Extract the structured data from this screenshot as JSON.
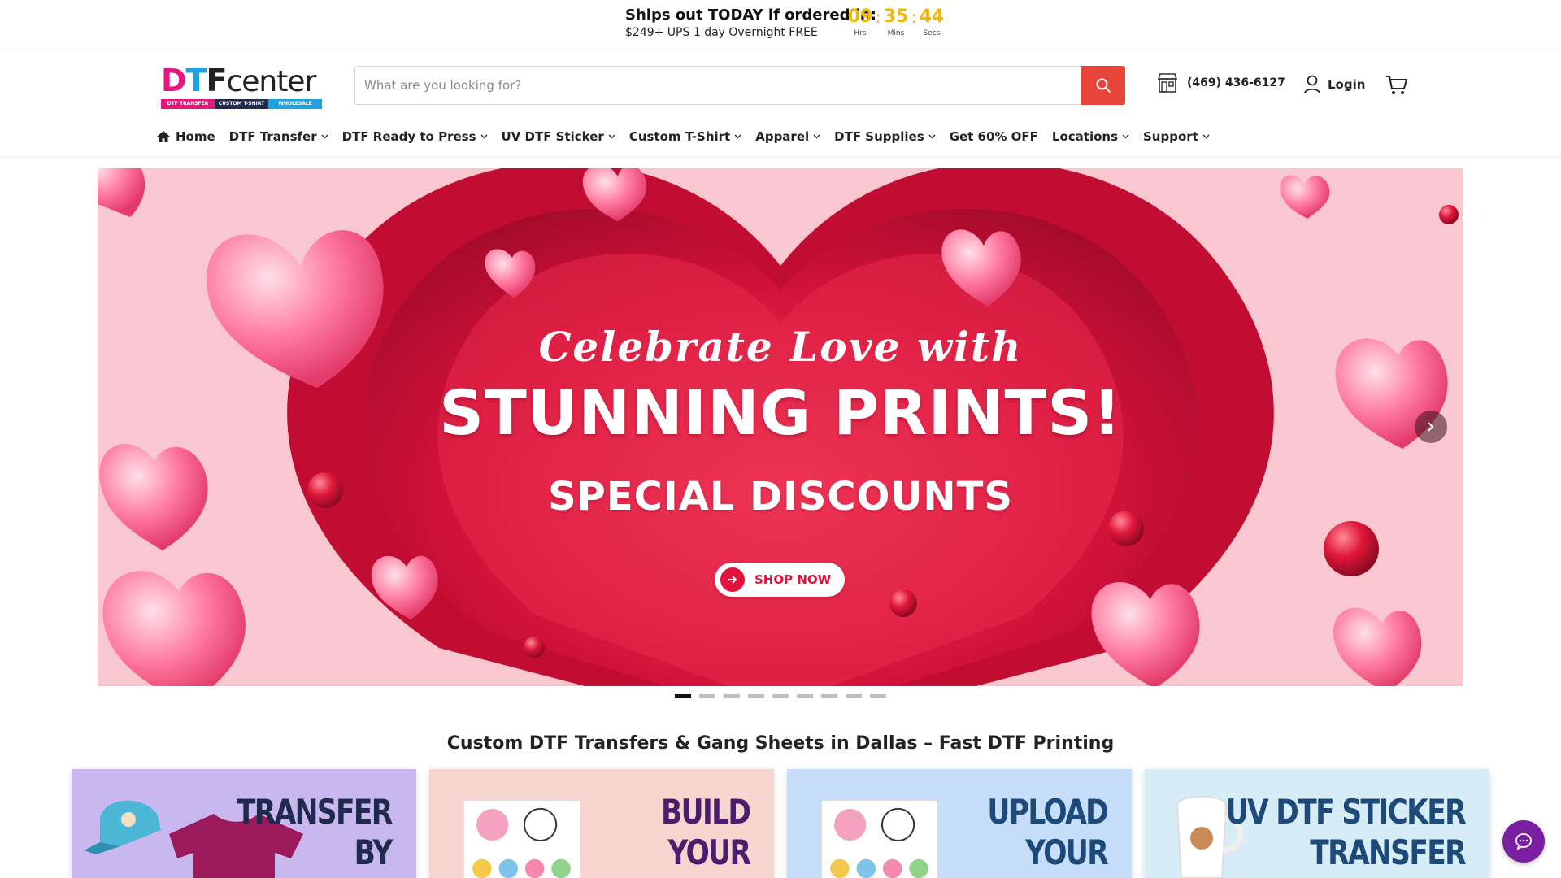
{
  "promo": {
    "title": "Ships out TODAY if ordered in:",
    "subtitle": "$249+ UPS 1 day Overnight FREE",
    "countdown": {
      "hours": "09",
      "minutes": "35",
      "seconds": "44",
      "hours_label": "Hrs",
      "minutes_label": "Mins",
      "seconds_label": "Secs",
      "separator": ":"
    }
  },
  "header": {
    "logo": {
      "word_d": "D",
      "word_t": "T",
      "word_f": "F",
      "word_rest": "center",
      "strip": [
        "DTF TRANSFER",
        "CUSTOM T-SHIRT",
        "WHOLESALE"
      ]
    },
    "search": {
      "placeholder": "What are you looking for?",
      "value": ""
    },
    "phone": "(469) 436-6127",
    "login_label": "Login"
  },
  "nav": {
    "items": [
      {
        "label": "Home",
        "icon": "home-icon",
        "dropdown": false
      },
      {
        "label": "DTF Transfer",
        "dropdown": true
      },
      {
        "label": "DTF Ready to Press",
        "dropdown": true
      },
      {
        "label": "UV DTF Sticker",
        "dropdown": true
      },
      {
        "label": "Custom T-Shirt",
        "dropdown": true
      },
      {
        "label": "Apparel",
        "dropdown": true
      },
      {
        "label": "DTF Supplies",
        "dropdown": true
      },
      {
        "label": "Get 60% OFF",
        "dropdown": false
      },
      {
        "label": "Locations",
        "dropdown": true
      },
      {
        "label": "Support",
        "dropdown": true
      }
    ]
  },
  "hero": {
    "script": "Celebrate Love with",
    "title": "STUNNING PRINTS!",
    "subtitle": "SPECIAL DISCOUNTS",
    "cta": "SHOP NOW",
    "slide_count": 9,
    "active_slide": 1
  },
  "section": {
    "title": "Custom DTF Transfers & Gang Sheets in Dallas – Fast DTF Printing"
  },
  "cards": [
    {
      "line1": "TRANSFER",
      "line2": "BY",
      "bg": "#c9b8ef",
      "color": "#1f2a4d"
    },
    {
      "line1": "BUILD",
      "line2": "YOUR",
      "bg": "#f6d6cf",
      "color": "#4a1e6d"
    },
    {
      "line1": "UPLOAD",
      "line2": "YOUR",
      "bg": "#c7defa",
      "color": "#1e4a7a"
    },
    {
      "line1": "UV DTF STICKER",
      "line2": "TRANSFER",
      "bg": "#d6ecf7",
      "color": "#1e4a7a",
      "accent": "#b01a3a"
    }
  ],
  "colors": {
    "accent": "#e9463a",
    "countdown": "#f2b705",
    "hero_red": "#e1123b",
    "chat": "#7b1fa2"
  }
}
